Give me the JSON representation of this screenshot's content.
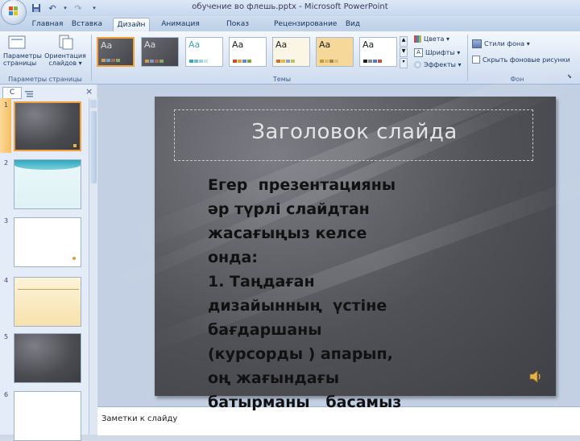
{
  "window": {
    "title": "обучение во флешь.pptx - Microsoft PowerPoint"
  },
  "tabs": [
    {
      "label": "Главная"
    },
    {
      "label": "Вставка"
    },
    {
      "label": "Дизайн",
      "active": true
    },
    {
      "label": "Анимация"
    },
    {
      "label": "Показ слайдов"
    },
    {
      "label": "Рецензирование"
    },
    {
      "label": "Вид"
    }
  ],
  "ribbon": {
    "page_setup": {
      "btn1": "Параметры страницы",
      "btn2": "Ориентация слайдов ▾",
      "group": "Параметры страницы"
    },
    "themes": {
      "group": "Темы",
      "sample": "Aa"
    },
    "theme_options": {
      "colors": "Цвета ▾",
      "fonts": "Шрифты ▾",
      "effects": "Эффекты ▾"
    },
    "background": {
      "styles": "Стили фона ▾",
      "hide": "Скрыть фоновые рисунки",
      "group": "Фон"
    }
  },
  "pane": {
    "tab_letter": "С",
    "close": "×"
  },
  "thumbnails": [
    {
      "num": "1",
      "style": "dark"
    },
    {
      "num": "2",
      "style": "aqua"
    },
    {
      "num": "3",
      "style": "white"
    },
    {
      "num": "4",
      "style": "cream"
    },
    {
      "num": "5",
      "style": "dark"
    },
    {
      "num": "6",
      "style": "white"
    }
  ],
  "slide": {
    "title": "Заголовок слайда",
    "body": "Егер  презентацияны\nәр түрлі слайдтан\nжасағыңыз келсе\nонда:\n1. Таңдаған\nдизайынның  үстіне\nбағдаршаны\n(курсорды ) апарып,\nоң жағындағы\nбатырманы   басамыз"
  },
  "notes": {
    "placeholder": "Заметки к слайду"
  },
  "colors": {
    "accent": "#f2a03c",
    "ribbon": "#dbe6f4",
    "slide_bg": "#505156"
  }
}
